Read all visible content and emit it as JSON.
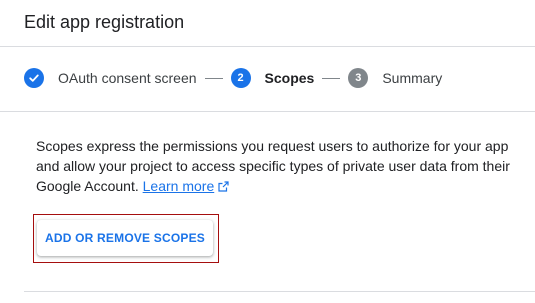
{
  "header": {
    "title": "Edit app registration"
  },
  "stepper": {
    "steps": [
      {
        "label": "OAuth consent screen",
        "state": "completed",
        "icon": "check-icon"
      },
      {
        "label": "Scopes",
        "number": "2",
        "state": "active"
      },
      {
        "label": "Summary",
        "number": "3",
        "state": "pending"
      }
    ]
  },
  "content": {
    "description": "Scopes express the permissions you request users to authorize for your app and allow your project to access specific types of private user data from their Google Account.",
    "learn_more_label": "Learn more",
    "learn_more_icon": "external-link-icon"
  },
  "actions": {
    "add_remove_scopes_label": "ADD OR REMOVE SCOPES"
  },
  "colors": {
    "accent": "#1a73e8",
    "pending": "#80868b",
    "highlight_border": "#a50e0e"
  }
}
